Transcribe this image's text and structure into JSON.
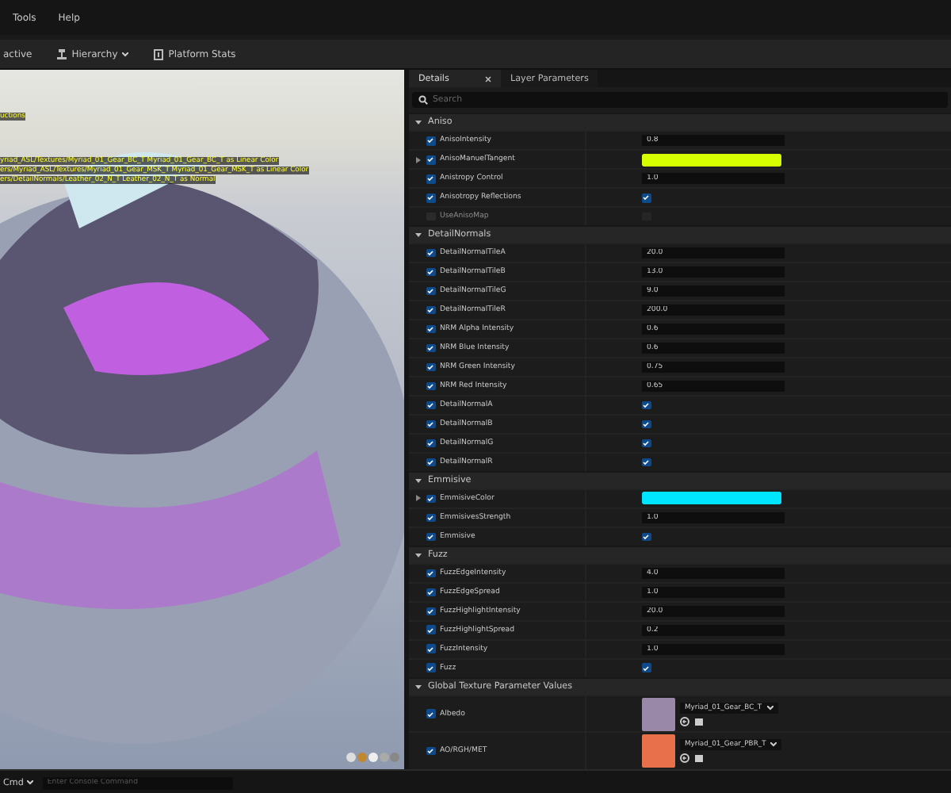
{
  "menu": [
    "Tools",
    "Help"
  ],
  "toolbar": [
    {
      "label": "active",
      "dropdown": false
    },
    {
      "label": "Hierarchy",
      "dropdown": true
    },
    {
      "label": "Platform Stats",
      "dropdown": false
    }
  ],
  "viewport": {
    "messages": [
      "uctions",
      "yriad_ASL/Textures/Myriad_01_Gear_BC_T Myriad_01_Gear_BC_T as Linear Color",
      "ers/Myriad_ASL/Textures/Myriad_01_Gear_MSK_T Myriad_01_Gear_MSK_T as Linear Color",
      "ers/DetailNormals/Leather_02_N_T Leather_02_N_T as Normal"
    ]
  },
  "tabs": [
    {
      "label": "Details",
      "selected": true,
      "closable": true
    },
    {
      "label": "Layer Parameters",
      "selected": false,
      "closable": false
    }
  ],
  "search": {
    "placeholder": "Search"
  },
  "sections": [
    {
      "title": "Aniso",
      "expanded": true,
      "rows": [
        {
          "kind": "value",
          "name": "AnisoIntensity",
          "enabled": true,
          "value": "0.8"
        },
        {
          "kind": "color",
          "name": "AnisoManuelTangent",
          "enabled": true,
          "color": "#d8ff00"
        },
        {
          "kind": "value",
          "name": "Anistropy Control",
          "enabled": true,
          "value": "1.0"
        },
        {
          "kind": "check",
          "name": "Anisotropy Reflections",
          "enabled": true,
          "checked": true
        },
        {
          "kind": "check",
          "name": "UseAnisoMap",
          "enabled": false,
          "checked": false
        }
      ]
    },
    {
      "title": "DetailNormals",
      "expanded": true,
      "rows": [
        {
          "kind": "value",
          "name": "DetailNormalTileA",
          "enabled": true,
          "value": "20.0"
        },
        {
          "kind": "value",
          "name": "DetailNormalTileB",
          "enabled": true,
          "value": "13.0"
        },
        {
          "kind": "value",
          "name": "DetailNormalTileG",
          "enabled": true,
          "value": "9.0"
        },
        {
          "kind": "value",
          "name": "DetailNormalTileR",
          "enabled": true,
          "value": "200.0"
        },
        {
          "kind": "value",
          "name": "NRM Alpha Intensity",
          "enabled": true,
          "value": "0.6"
        },
        {
          "kind": "value",
          "name": "NRM Blue Intensity",
          "enabled": true,
          "value": "0.6"
        },
        {
          "kind": "value",
          "name": "NRM Green Intensity",
          "enabled": true,
          "value": "0.75"
        },
        {
          "kind": "value",
          "name": "NRM Red Intensity",
          "enabled": true,
          "value": "0.65"
        },
        {
          "kind": "check",
          "name": "DetailNormalA",
          "enabled": true,
          "checked": true
        },
        {
          "kind": "check",
          "name": "DetailNormalB",
          "enabled": true,
          "checked": true
        },
        {
          "kind": "check",
          "name": "DetailNormalG",
          "enabled": true,
          "checked": true
        },
        {
          "kind": "check",
          "name": "DetailNormalR",
          "enabled": true,
          "checked": true
        }
      ]
    },
    {
      "title": "Emmisive",
      "expanded": true,
      "rows": [
        {
          "kind": "color",
          "name": "EmmisiveColor",
          "enabled": true,
          "color": "#00e5ff"
        },
        {
          "kind": "value",
          "name": "EmmisivesStrength",
          "enabled": true,
          "value": "1.0"
        },
        {
          "kind": "check",
          "name": "Emmisive",
          "enabled": true,
          "checked": true
        }
      ]
    },
    {
      "title": "Fuzz",
      "expanded": true,
      "rows": [
        {
          "kind": "value",
          "name": "FuzzEdgeIntensity",
          "enabled": true,
          "value": "4.0"
        },
        {
          "kind": "value",
          "name": "FuzzEdgeSpread",
          "enabled": true,
          "value": "1.0"
        },
        {
          "kind": "value",
          "name": "FuzzHighlightIntensity",
          "enabled": true,
          "value": "20.0"
        },
        {
          "kind": "value",
          "name": "FuzzHighlightSpread",
          "enabled": true,
          "value": "0.2"
        },
        {
          "kind": "value",
          "name": "FuzzIntensity",
          "enabled": true,
          "value": "1.0"
        },
        {
          "kind": "check",
          "name": "Fuzz",
          "enabled": true,
          "checked": true
        }
      ]
    },
    {
      "title": "Global Texture Parameter Values",
      "expanded": true,
      "rows": [
        {
          "kind": "texture",
          "name": "Albedo",
          "enabled": true,
          "texture": "Myriad_01_Gear_BC_T",
          "color": "#9a88a8"
        },
        {
          "kind": "texture",
          "name": "AO/RGH/MET",
          "enabled": true,
          "texture": "Myriad_01_Gear_PBR_T",
          "color": "#e8704a"
        }
      ]
    }
  ],
  "console": {
    "label": "Cmd",
    "placeholder": "Enter Console Command"
  }
}
